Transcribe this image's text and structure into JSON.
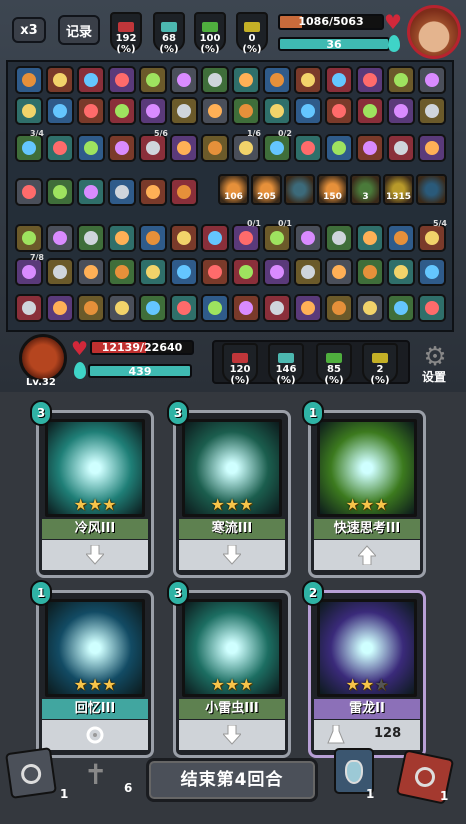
{
  "top_bar": {
    "speed_label": "x3",
    "record_label": "记录",
    "stats": [
      {
        "icon": "sword-icon",
        "value": "192",
        "unit": "(%)",
        "color": "#c0363a"
      },
      {
        "icon": "shield-icon",
        "value": "68",
        "unit": "(%)",
        "color": "#4cb8b0"
      },
      {
        "icon": "heal-icon",
        "value": "100",
        "unit": "(%)",
        "color": "#4faf3e"
      },
      {
        "icon": "lightning-icon",
        "value": "0",
        "unit": "(%)",
        "color": "#c4b026"
      }
    ],
    "hp_text": "1086/5063",
    "hp_fraction": 0.214,
    "mana_text": "36",
    "mana_fraction": 1.0
  },
  "inventory": {
    "badges": [
      "3/4",
      "5/6",
      "1/6",
      "0/2",
      "0/1",
      "0/1",
      "0/1",
      "5/4",
      "7/8"
    ],
    "highlight_counts": [
      "106",
      "205",
      "150",
      "3",
      "1315"
    ]
  },
  "player": {
    "level": "Lv.32",
    "hp_text": "12139/22640",
    "hp_fraction": 0.536,
    "mana_text": "439",
    "mana_fraction": 1.0,
    "stats": [
      {
        "icon": "sword-icon",
        "value": "120",
        "unit": "(%)",
        "color": "#c0363a"
      },
      {
        "icon": "shield-icon",
        "value": "146",
        "unit": "(%)",
        "color": "#4cb8b0"
      },
      {
        "icon": "heal-icon",
        "value": "85",
        "unit": "(%)",
        "color": "#4faf3e"
      },
      {
        "icon": "lightning-icon",
        "value": "2",
        "unit": "(%)",
        "color": "#c4b026"
      }
    ],
    "settings_label": "设置"
  },
  "cards": [
    {
      "name": "冷风III",
      "cost": "3",
      "stars": 3,
      "art_color": "#1f7f77",
      "name_bg": "#5e8150",
      "icon": "vortex-icon",
      "action": "down-arrow-icon"
    },
    {
      "name": "寒流III",
      "cost": "3",
      "stars": 3,
      "art_color": "#1b5e4e",
      "name_bg": "#5e8150",
      "icon": "frost-stream-icon",
      "action": "down-arrow-icon"
    },
    {
      "name": "快速思考III",
      "cost": "1",
      "stars": 3,
      "art_color": "#3c7a1e",
      "name_bg": "#5e8150",
      "icon": "thinking-figure-icon",
      "action": "up-arrow-icon"
    },
    {
      "name": "回忆III",
      "cost": "1",
      "stars": 3,
      "art_color": "#124b64",
      "name_bg": "#41a6a0",
      "icon": "skull-mist-icon",
      "action": "swirl-icon"
    },
    {
      "name": "小雷虫III",
      "cost": "3",
      "stars": 3,
      "art_color": "#1c6e62",
      "name_bg": "#5e8150",
      "icon": "thunder-bug-icon",
      "action": "down-arrow-icon"
    },
    {
      "name": "雷龙II",
      "cost": "2",
      "stars": 2,
      "art_color": "#3a2a7a",
      "name_bg": "#8c70b8",
      "icon": "thunder-dragon-icon",
      "action": "potion-icon",
      "extra": "128"
    }
  ],
  "footer": {
    "draw_pile_count": "1",
    "discard_count": "6",
    "end_turn_label": "结束第4回合",
    "potion_count": "1",
    "exhaust_count": "1"
  }
}
